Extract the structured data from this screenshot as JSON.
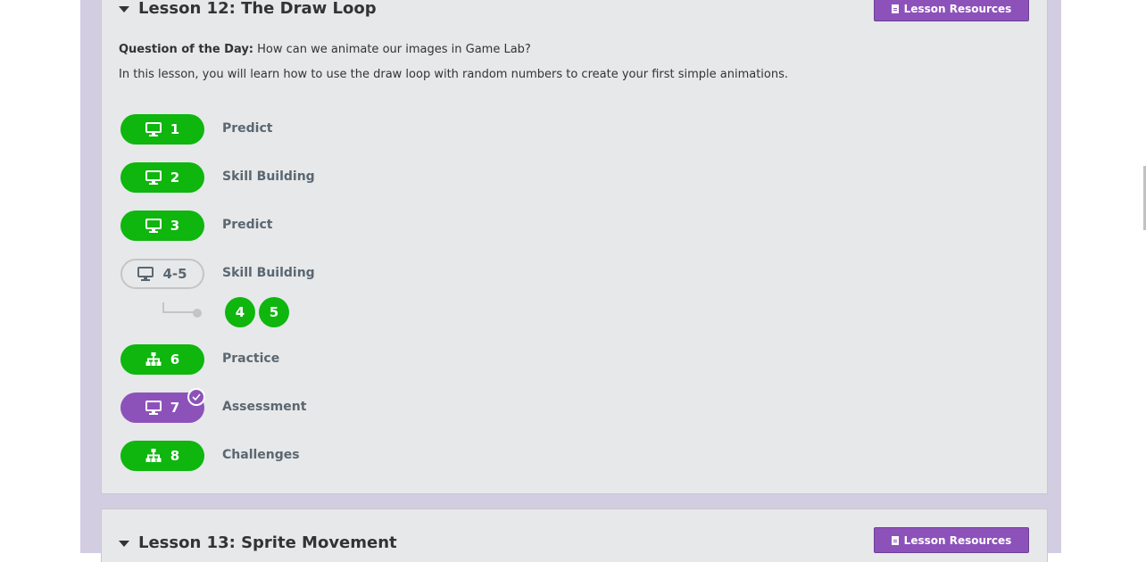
{
  "lesson12": {
    "title": "Lesson 12: The Draw Loop",
    "resources_label": "Lesson Resources",
    "question_label": "Question of the Day:",
    "question_text": " How can we animate our images in Game Lab?",
    "description": "In this lesson, you will learn how to use the draw loop with random numbers to create your first simple animations.",
    "levels": [
      {
        "number": "1",
        "label": "Predict",
        "icon": "desktop-icon",
        "status": "complete"
      },
      {
        "number": "2",
        "label": "Skill Building",
        "icon": "desktop-icon",
        "status": "complete"
      },
      {
        "number": "3",
        "label": "Predict",
        "icon": "desktop-icon",
        "status": "complete"
      },
      {
        "number": "4-5",
        "label": "Skill Building",
        "icon": "desktop-icon",
        "status": "in-progress",
        "sublevels": [
          "4",
          "5"
        ]
      },
      {
        "number": "6",
        "label": "Practice",
        "icon": "sitemap-icon",
        "status": "complete"
      },
      {
        "number": "7",
        "label": "Assessment",
        "icon": "desktop-icon",
        "status": "submitted"
      },
      {
        "number": "8",
        "label": "Challenges",
        "icon": "sitemap-icon",
        "status": "complete"
      }
    ]
  },
  "lesson13": {
    "title": "Lesson 13: Sprite Movement",
    "resources_label": "Lesson Resources"
  },
  "colors": {
    "complete_green": "#0eb60e",
    "submitted_purple": "#8c52ba",
    "panel_bg": "#e6e8ea",
    "outer_bg": "#d3cde2",
    "label_gray": "#5b6770"
  }
}
